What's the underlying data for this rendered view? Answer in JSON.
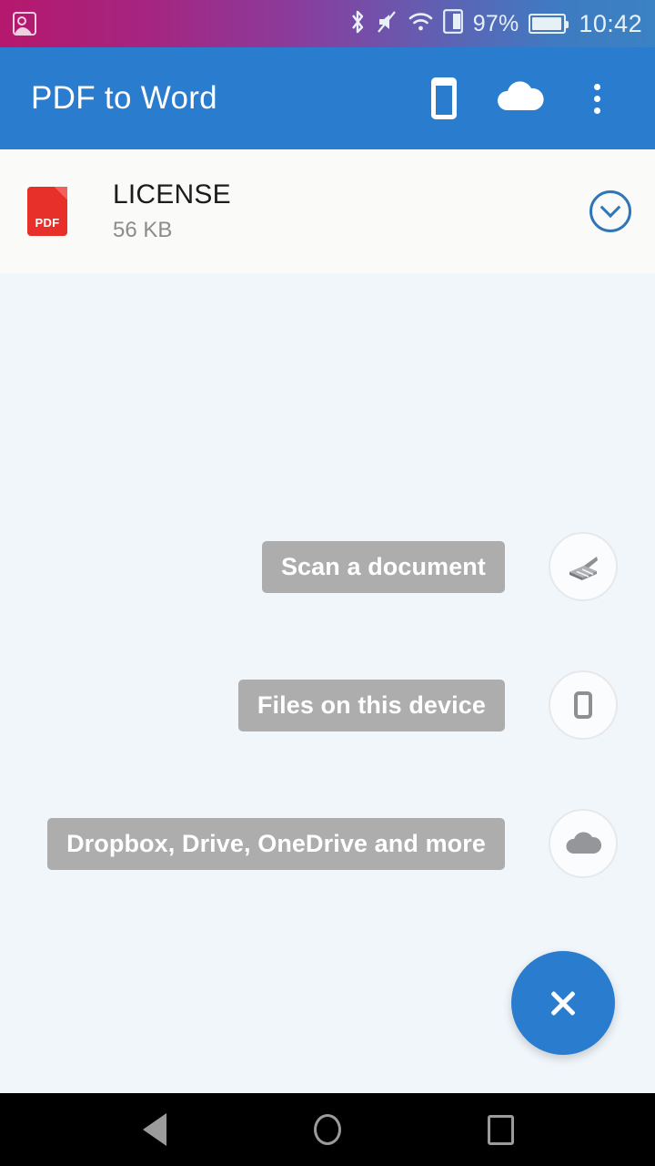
{
  "status_bar": {
    "left_icon": "photo-icon",
    "icons": [
      "bluetooth-icon",
      "mute-icon",
      "wifi-icon",
      "sd-card-icon"
    ],
    "battery_percent": "97%",
    "battery_icon": "battery-icon",
    "clock": "10:42"
  },
  "app_bar": {
    "title": "PDF to Word",
    "actions": [
      {
        "name": "device-files-action",
        "icon": "phone-icon"
      },
      {
        "name": "cloud-storage-action",
        "icon": "cloud-icon"
      },
      {
        "name": "overflow-menu-action",
        "icon": "more-vertical-icon"
      }
    ]
  },
  "file_list": [
    {
      "icon": "pdf-file-icon",
      "icon_label": "PDF",
      "name": "LICENSE",
      "size": "56 KB",
      "expand_icon": "chevron-down-circle-icon"
    }
  ],
  "fab_menu": {
    "items": [
      {
        "label": "Scan a document",
        "icon": "scanner-icon"
      },
      {
        "label": "Files on this device",
        "icon": "phone-icon"
      },
      {
        "label": "Dropbox, Drive, OneDrive and more",
        "icon": "cloud-icon"
      }
    ],
    "main_icon": "close-icon"
  },
  "nav_bar": {
    "back": "back-icon",
    "home": "home-icon",
    "recents": "recents-icon"
  },
  "colors": {
    "accent": "#2a7cce",
    "pdf_red": "#e8302a",
    "chip_gray": "#adadad",
    "page_bg": "#f1f6fb",
    "card_bg": "#fafaf9"
  }
}
